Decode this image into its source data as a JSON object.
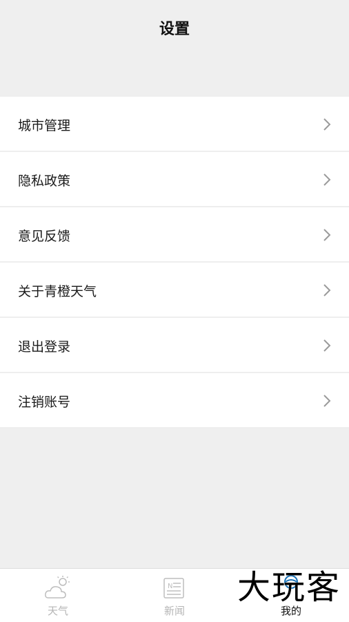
{
  "header": {
    "title": "设置"
  },
  "menu": {
    "items": [
      {
        "label": "城市管理"
      },
      {
        "label": "隐私政策"
      },
      {
        "label": "意见反馈"
      },
      {
        "label": "关于青橙天气"
      },
      {
        "label": "退出登录"
      },
      {
        "label": "注销账号"
      }
    ]
  },
  "tabbar": {
    "tabs": [
      {
        "label": "天气",
        "icon": "weather-cloud-sun-icon"
      },
      {
        "label": "新闻",
        "icon": "news-icon"
      },
      {
        "label": "我的",
        "icon": "profile-icon",
        "active": true
      }
    ]
  },
  "watermark": {
    "text": "大玩客"
  },
  "colors": {
    "background": "#efefef",
    "card": "#ffffff",
    "inactive_tab": "#b5b5b5",
    "active_tab": "#111111"
  }
}
